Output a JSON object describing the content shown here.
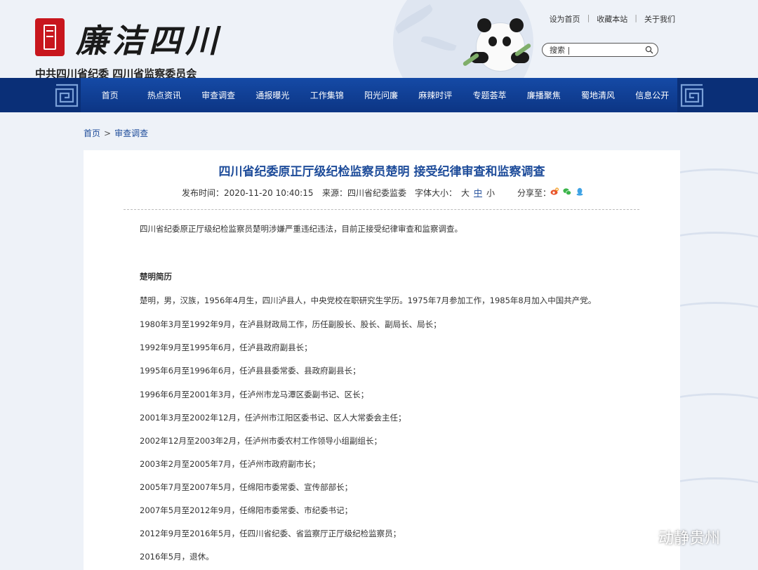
{
  "header": {
    "calligraphy": "廉洁四川",
    "org_name": "中共四川省纪委 四川省监察委员会",
    "toplinks": [
      "设为首页",
      "收藏本站",
      "关于我们"
    ],
    "toplinks_sep": "|",
    "search_placeholder": "搜索 |"
  },
  "nav": {
    "items": [
      "首页",
      "热点资讯",
      "审查调查",
      "通报曝光",
      "工作集锦",
      "阳光问廉",
      "麻辣时评",
      "专题荟萃",
      "廉播聚焦",
      "蜀地清风",
      "信息公开"
    ]
  },
  "breadcrumb": {
    "home": "首页",
    "separator": ">",
    "current": "审查调查"
  },
  "article": {
    "title": "四川省纪委原正厅级纪检监察员楚明 接受纪律审查和监察调查",
    "publish_label": "发布时间：",
    "publish_time": "2020-11-20 10:40:15",
    "source_label": "来源：",
    "source": "四川省纪委监委",
    "fontsize_label": "字体大小：",
    "fontsize_options": [
      "大",
      "中",
      "小"
    ],
    "fontsize_selected": "中",
    "share_label": "分享至：",
    "share_icons": [
      "weibo-icon",
      "wechat-icon",
      "qq-icon"
    ],
    "paragraphs": [
      "四川省纪委原正厅级纪检监察员楚明涉嫌严重违纪违法，目前正接受纪律审查和监察调查。",
      "楚明简历",
      "楚明，男，汉族，1956年4月生，四川泸县人，中央党校在职研究生学历。1975年7月参加工作，1985年8月加入中国共产党。",
      "1980年3月至1992年9月，在泸县财政局工作，历任副股长、股长、副局长、局长；",
      "1992年9月至1995年6月，任泸县政府副县长；",
      "1995年6月至1996年6月，任泸县县委常委、县政府副县长；",
      "1996年6月至2001年3月，任泸州市龙马潭区委副书记、区长；",
      "2001年3月至2002年12月，任泸州市江阳区委书记、区人大常委会主任；",
      "2002年12月至2003年2月，任泸州市委农村工作领导小组副组长；",
      "2003年2月至2005年7月，任泸州市政府副市长；",
      "2005年7月至2007年5月，任绵阳市委常委、宣传部部长；",
      "2007年5月至2012年9月，任绵阳市委常委、市纪委书记；",
      "2012年9月至2016年5月，任四川省纪委、省监察厅正厅级纪检监察员；",
      "2016年5月，退休。"
    ]
  },
  "watermark": {
    "text": "动静贵州"
  },
  "colors": {
    "nav_blue": "#0f3d91",
    "title_blue": "#1e4c9a",
    "logo_red": "#c8161d",
    "background": "#eef2f8"
  }
}
